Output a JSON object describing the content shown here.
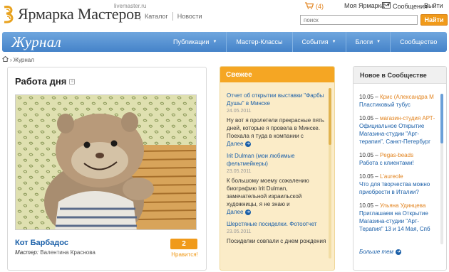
{
  "header": {
    "logo_text": "Ярмарка Мастеров",
    "logo_domain": "livemaster.ru",
    "links": [
      "Каталог",
      "Новости"
    ],
    "cart_count": "(4)",
    "user_menu": "Моя Ярмарка",
    "messages": "Сообщения",
    "logout": "Выйти",
    "search_placeholder": "поиск",
    "search_button": "Найти"
  },
  "nav": {
    "title": "Журнал",
    "items": [
      {
        "label": "Публикации",
        "dropdown": true
      },
      {
        "label": "Мастер-Классы",
        "dropdown": false
      },
      {
        "label": "События",
        "dropdown": true
      },
      {
        "label": "Блоги",
        "dropdown": true
      },
      {
        "label": "Сообщество",
        "dropdown": false
      }
    ]
  },
  "breadcrumb": {
    "separator": "›",
    "current": "Журнал"
  },
  "work_of_day": {
    "heading": "Работа дня",
    "name": "Кот Барбадос",
    "author_label": "Мастер:",
    "author": "Валентина Краснова",
    "likes": "2",
    "like_label": "Нравится!"
  },
  "fresh": {
    "heading": "Свежее",
    "more_label": "Далее",
    "items": [
      {
        "title": "Отчет об открытии выставки \"Фарбы Душы\" в Минске",
        "date": "24.05.2011",
        "text": "Ну вот я пролетели прекрасные пять дней, которые я провела в Минске. Поехала я туда в компании с"
      },
      {
        "title": "Irit Dulman (мои любимые фельтмейкеры)",
        "date": "23.05.2011",
        "text": "К большому моему сожалению биографию Irit Dulman, замечательной израильской художницы, я не знаю и"
      },
      {
        "title": "Шерстяные посиделки. Фотоотчет",
        "date": "23.05.2011",
        "text": "Посиделки совпали с днем рождения"
      }
    ]
  },
  "community": {
    "heading": "Новое в Сообществе",
    "more_label": "Больше тем",
    "items": [
      {
        "date": "10.05",
        "author": "Крис (Александра М",
        "topic": "Пластиковый тубус"
      },
      {
        "date": "10.05",
        "author": "магазин-студия АРТ-",
        "topic": "Официальное Открытие Магазина-студии \"Арт-терапия\", Санкт-Петербург"
      },
      {
        "date": "10.05",
        "author": "Pegas-beads",
        "topic": "Работа с клиентами!"
      },
      {
        "date": "10.05",
        "author": "L'aureole",
        "topic": "Что для творчества можно приобрести в Италии?"
      },
      {
        "date": "10.05",
        "author": "Ульяна Удинцева",
        "topic": "Приглашаем на Открытие Магазина-студии \"Арт-Терапия\" 13 и 14 Мая, Спб"
      }
    ]
  }
}
